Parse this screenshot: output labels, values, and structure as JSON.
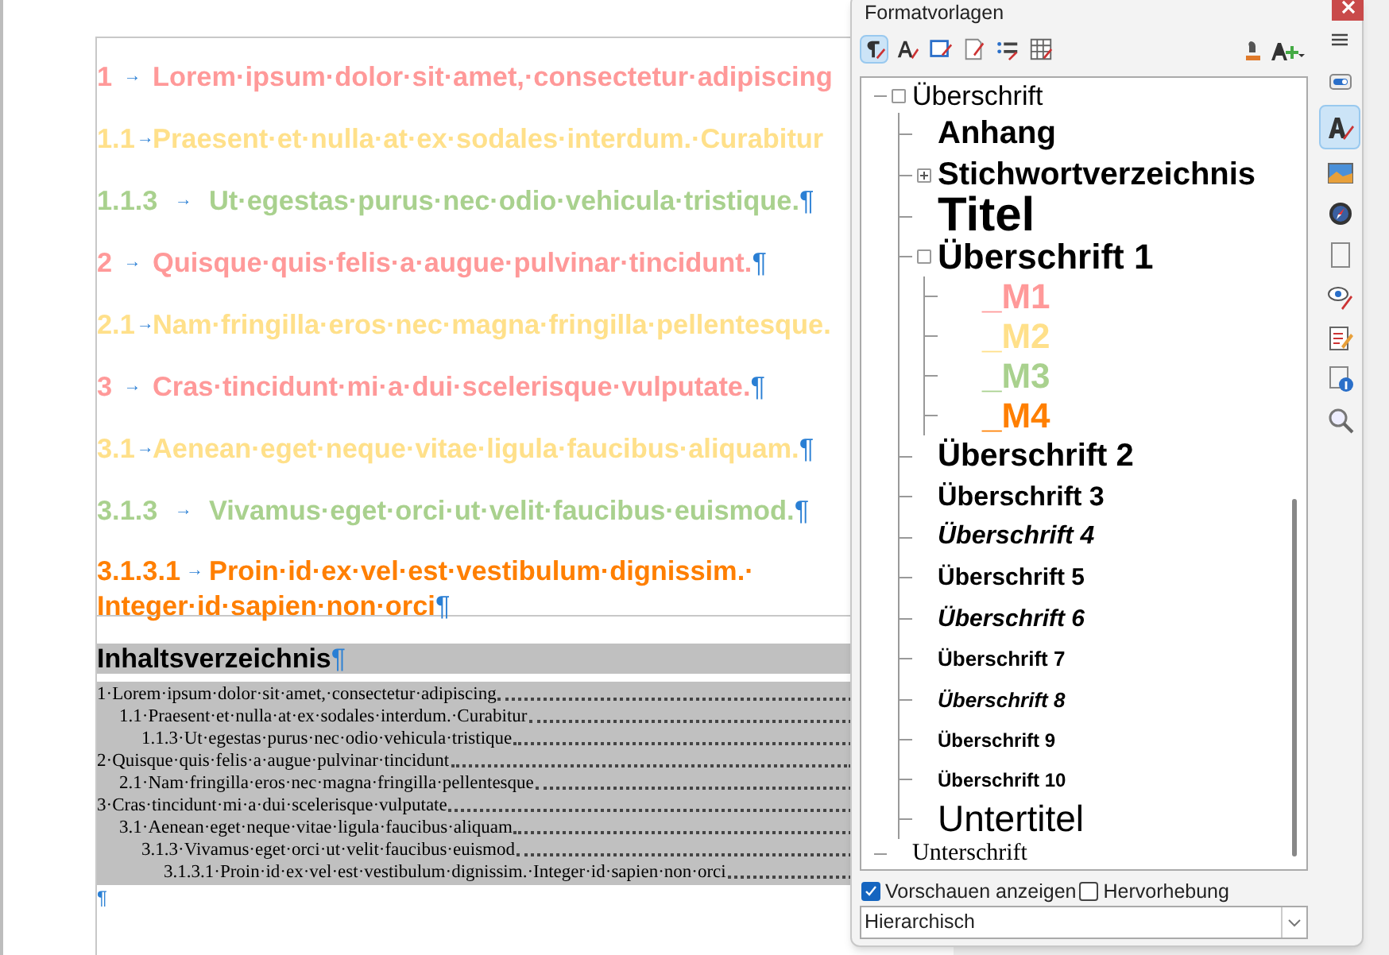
{
  "document": {
    "headings": [
      {
        "number": "1",
        "tab": "→",
        "text": "Lorem·ipsum·dolor·sit·amet,·consectetur·adipiscing",
        "color": "#ff9999"
      },
      {
        "number": "1.1",
        "tab": "→",
        "text": "Praesent·et·nulla·at·ex·sodales·interdum.·Curabitur",
        "color": "#ffe08a"
      },
      {
        "number": "1.1.3",
        "tab": "→",
        "text": "Ut·egestas·purus·nec·odio·vehicula·tristique.",
        "pilcrow": "¶",
        "color": "#a9d18e"
      },
      {
        "number": "2",
        "tab": "→",
        "text": "Quisque·quis·felis·a·augue·pulvinar·tincidunt.",
        "pilcrow": "¶",
        "color": "#ff9999"
      },
      {
        "number": "2.1",
        "tab": "→",
        "text": "Nam·fringilla·eros·nec·magna·fringilla·pellentesque.",
        "color": "#ffe08a"
      },
      {
        "number": "3",
        "tab": "→",
        "text": "Cras·tincidunt·mi·a·dui·scelerisque·vulputate.",
        "pilcrow": "¶",
        "color": "#ff9999"
      },
      {
        "number": "3.1",
        "tab": "→",
        "text": "Aenean·eget·neque·vitae·ligula·faucibus·aliquam.",
        "pilcrow": "¶",
        "color": "#ffe08a"
      },
      {
        "number": "3.1.3",
        "tab": "→",
        "text": "Vivamus·eget·orci·ut·velit·faucibus·euismod.",
        "pilcrow": "¶",
        "color": "#a9d18e"
      },
      {
        "number": "3.1.3.1",
        "tab": "→",
        "text": "Proin·id·ex·vel·est·vestibulum·dignissim.·",
        "text_line_2": "Integer·id·sapien·non·orci",
        "pilcrow": "¶",
        "color": "#ff7f00"
      }
    ],
    "toc_title": "Inhaltsverzeichnis",
    "toc_title_pilcrow": "¶",
    "toc": [
      {
        "text": "1·Lorem·ipsum·dolor·sit·amet,·consectetur·adipiscing",
        "children": [
          {
            "text": "1.1·Praesent·et·nulla·at·ex·sodales·interdum.·Curabitur",
            "children": [
              {
                "text": "1.1.3·Ut·egestas·purus·nec·odio·vehicula·tristique"
              }
            ]
          }
        ]
      },
      {
        "text": "2·Quisque·quis·felis·a·augue·pulvinar·tincidunt",
        "children": [
          {
            "text": "2.1·Nam·fringilla·eros·nec·magna·fringilla·pellentesque"
          }
        ]
      },
      {
        "text": "3·Cras·tincidunt·mi·a·dui·scelerisque·vulputate",
        "children": [
          {
            "text": "3.1·Aenean·eget·neque·vitae·ligula·faucibus·aliquam",
            "children": [
              {
                "text": "3.1.3·Vivamus·eget·orci·ut·velit·faucibus·euismod",
                "children": [
                  {
                    "text": "3.1.3.1·Proin·id·ex·vel·est·vestibulum·dignissim.·Integer·id·sapien·non·orci"
                  }
                ]
              }
            ]
          }
        ]
      }
    ],
    "end_pilcrow": "¶"
  },
  "styles_panel": {
    "title": "Formatvorlagen",
    "toolbar": [
      {
        "kind": "paragraph",
        "selected": true
      },
      {
        "kind": "character",
        "selected": false
      },
      {
        "kind": "frame",
        "selected": false
      },
      {
        "kind": "page",
        "selected": false
      },
      {
        "kind": "list",
        "selected": false
      },
      {
        "kind": "table",
        "selected": false
      }
    ],
    "tree": [
      {
        "label": "Überschrift",
        "kind": "plain",
        "expanded": true,
        "children": [
          {
            "label": "Anhang",
            "kind": "h_large"
          },
          {
            "label": "Stichwortverzeichnis",
            "kind": "h_large",
            "expanded": false
          },
          {
            "label": "Titel",
            "kind": "title"
          },
          {
            "label": "Überschrift 1",
            "kind": "h1",
            "expanded": true,
            "children": [
              {
                "label": "_M1",
                "kind": "h1",
                "color": "#ff9999"
              },
              {
                "label": "_M2",
                "kind": "h1",
                "color": "#ffe08a"
              },
              {
                "label": "_M3",
                "kind": "h1",
                "color": "#a9d18e"
              },
              {
                "label": "_M4",
                "kind": "h1",
                "color": "#ff7f00"
              }
            ]
          },
          {
            "label": "Überschrift 2",
            "kind": "h_large"
          },
          {
            "label": "Überschrift 3",
            "kind": "h3"
          },
          {
            "label": "Überschrift 4",
            "kind": "h4"
          },
          {
            "label": "Überschrift 5",
            "kind": "h5"
          },
          {
            "label": "Überschrift 6",
            "kind": "h6"
          },
          {
            "label": "Überschrift 7",
            "kind": "h7"
          },
          {
            "label": "Überschrift 8",
            "kind": "h8"
          },
          {
            "label": "Überschrift 9",
            "kind": "h9"
          },
          {
            "label": "Überschrift 10",
            "kind": "h9"
          },
          {
            "label": "Untertitel",
            "kind": "subtitle"
          }
        ]
      },
      {
        "label": "Unterschrift",
        "kind": "serif"
      }
    ],
    "options": [
      {
        "label": "Vorschauen anzeigen",
        "checked": true
      },
      {
        "label": "Hervorhebung",
        "checked": false
      }
    ],
    "filter": "Hierarchisch"
  },
  "sidebar_tabs": [
    {
      "kind": "menu",
      "selected": false
    },
    {
      "kind": "properties",
      "selected": false
    },
    {
      "kind": "styles",
      "selected": true
    },
    {
      "kind": "gallery",
      "selected": false
    },
    {
      "kind": "navigator",
      "selected": false
    },
    {
      "kind": "page",
      "selected": false
    },
    {
      "kind": "inspector",
      "selected": false
    },
    {
      "kind": "changes",
      "selected": false
    },
    {
      "kind": "accessibility",
      "selected": false
    },
    {
      "kind": "find",
      "selected": false
    }
  ]
}
